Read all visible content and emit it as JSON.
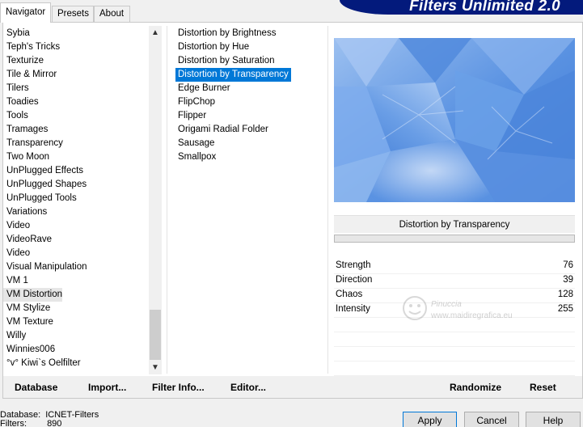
{
  "tabs": [
    {
      "label": "Navigator",
      "active": true
    },
    {
      "label": "Presets",
      "active": false
    },
    {
      "label": "About",
      "active": false
    }
  ],
  "banner": {
    "title": "Filters Unlimited 2.0"
  },
  "categories": [
    {
      "label": "Sybia"
    },
    {
      "label": "Teph's Tricks"
    },
    {
      "label": "Texturize"
    },
    {
      "label": "Tile & Mirror"
    },
    {
      "label": "Tilers"
    },
    {
      "label": "Toadies"
    },
    {
      "label": "Tools"
    },
    {
      "label": "Tramages"
    },
    {
      "label": "Transparency"
    },
    {
      "label": "Two Moon"
    },
    {
      "label": "UnPlugged Effects"
    },
    {
      "label": "UnPlugged Shapes"
    },
    {
      "label": "UnPlugged Tools"
    },
    {
      "label": "Variations"
    },
    {
      "label": "Video"
    },
    {
      "label": "VideoRave"
    },
    {
      "label": "Video"
    },
    {
      "label": "Visual Manipulation"
    },
    {
      "label": "VM 1"
    },
    {
      "label": "VM Distortion",
      "selected": true
    },
    {
      "label": "VM Stylize"
    },
    {
      "label": "VM Texture"
    },
    {
      "label": "Willy"
    },
    {
      "label": "Winnies006"
    },
    {
      "label": "°v° Kiwi`s Oelfilter"
    }
  ],
  "scrollbar": {
    "up_icon": "chevron-up-icon",
    "down_icon": "chevron-down-icon"
  },
  "filters": [
    {
      "label": "Distortion by Brightness"
    },
    {
      "label": "Distortion by Hue"
    },
    {
      "label": "Distortion by Saturation"
    },
    {
      "label": "Distortion by Transparency",
      "selected": true
    },
    {
      "label": "Edge Burner"
    },
    {
      "label": "FlipChop"
    },
    {
      "label": "Flipper"
    },
    {
      "label": "Origami Radial Folder"
    },
    {
      "label": "Sausage"
    },
    {
      "label": "Smallpox"
    }
  ],
  "preview": {
    "base_color": "#5b93e2",
    "light_color": "#a9c8f3",
    "dark_color": "#3d78d4"
  },
  "current_filter": {
    "name": "Distortion by Transparency",
    "progress": 0
  },
  "params": [
    {
      "name": "Strength",
      "value": "76"
    },
    {
      "name": "Direction",
      "value": "39"
    },
    {
      "name": "Chaos",
      "value": "128"
    },
    {
      "name": "Intensity",
      "value": "255"
    }
  ],
  "watermark": {
    "line1": "Pinuccia",
    "line2": "www.maidiregrafica.eu"
  },
  "toolbar": {
    "database": "Database",
    "import": "Import...",
    "filter_info": "Filter Info...",
    "editor": "Editor...",
    "randomize": "Randomize",
    "reset": "Reset"
  },
  "status": {
    "database_label": "Database:",
    "database_value": "ICNET-Filters",
    "filters_label": "Filters:",
    "filters_value": "890"
  },
  "dialog": {
    "apply": "Apply",
    "cancel": "Cancel",
    "help": "Help"
  },
  "colors": {
    "selection": "#0078d7",
    "banner": "#031a7c",
    "progress": "#06b025"
  }
}
